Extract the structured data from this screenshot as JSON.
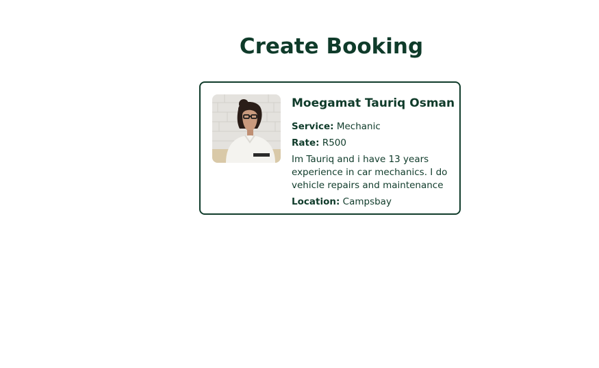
{
  "page": {
    "title": "Create Booking"
  },
  "provider": {
    "name": "Moegamat Tauriq Osman",
    "service_label": "Service:",
    "service": "Mechanic",
    "rate_label": "Rate:",
    "rate": "R500",
    "description": "Im Tauriq and i have 13 years experience in car mechanics. I do vehicle repairs and maintenance",
    "location_label": "Location:",
    "location": "Campsbay",
    "avatar": "provider-photo"
  },
  "colors": {
    "primary": "#0f3b2a",
    "background": "#ffffff"
  }
}
